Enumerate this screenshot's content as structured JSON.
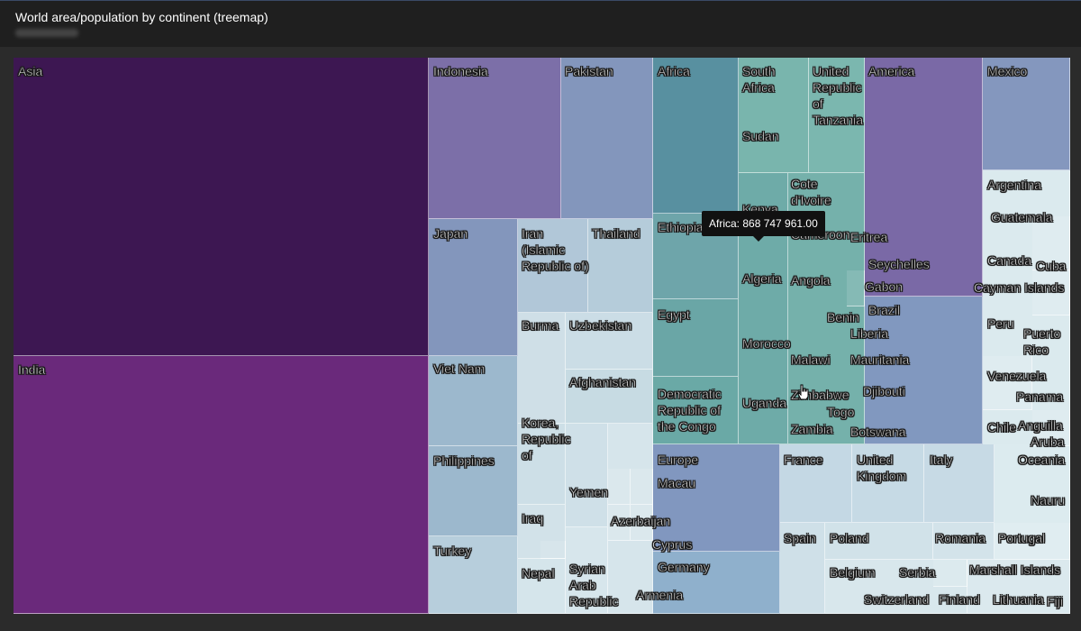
{
  "header": {
    "title": "World area/population by continent (treemap)"
  },
  "colors": {
    "asia": "#3d1752",
    "india": "#6a297b",
    "indonesia": "#7c6fa8",
    "pakistan": "#8396bc",
    "africa": "#5890a0",
    "america": "#7a69a6",
    "mexico": "#8497be",
    "light": "#dbeaee"
  },
  "tooltip": {
    "text": "Africa: 868 747 961.00"
  },
  "chart_data": {
    "type": "treemap",
    "title": "World area/population by continent (treemap)",
    "hovered": "Africa",
    "hovered_value": 868747961.0,
    "labels": [
      "Asia",
      "India",
      "Indonesia",
      "Pakistan",
      "Japan",
      "Iran\n(Islamic\nRepublic of)",
      "Thailand",
      "Viet Nam",
      "Burma",
      "Uzbekistan",
      "Afghanistan",
      "Korea,\nRepublic\nof",
      "Philippines",
      "Yemen",
      "Iraq",
      "Turkey",
      "Nepal",
      "Syrian\nArab\nRepublic",
      "Azerbaijan",
      "Armenia",
      "Africa",
      "South\nAfrica",
      "United\nRepublic\nof\nTanzania",
      "Sudan",
      "Cote\nd'Ivoire",
      "Kenya",
      "Ethiopia",
      "Cameroon",
      "Eritrea",
      "Algeria",
      "Angola",
      "Egypt",
      "Benin",
      "Morocco",
      "Liberia",
      "Malawi",
      "Mauritania",
      "Democratic\nRepublic of\nthe Congo",
      "Uganda",
      "Zimbabwe",
      "Djibouti",
      "Togo",
      "Zambia",
      "Botswana",
      "Seychelles",
      "Gabon",
      "America",
      "Mexico",
      "Argentina",
      "Guatemala",
      "Canada",
      "Cuba",
      "Cayman Islands",
      "Brazil",
      "Peru",
      "Puerto\nRico",
      "Venezuela",
      "Panama",
      "Chile",
      "Anguilla",
      "Aruba",
      "Europe",
      "Macau",
      "Cyprus",
      "Germany",
      "France",
      "United\nKingdom",
      "Italy",
      "Oceania",
      "Nauru",
      "Spain",
      "Poland",
      "Romania",
      "Portugal",
      "Belgium",
      "Serbia",
      "Marshall Islands",
      "Switzerland",
      "Finland",
      "Lithuania",
      "Fiji"
    ]
  }
}
